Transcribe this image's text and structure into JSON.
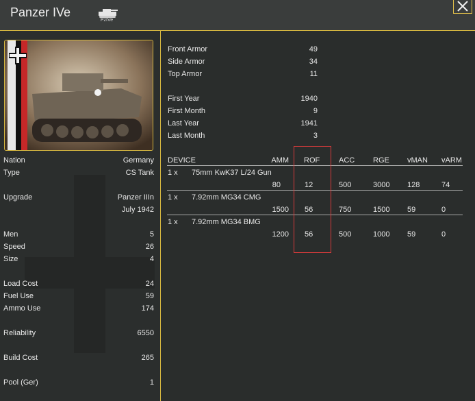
{
  "header": {
    "title": "Panzer IVe",
    "unit_icon_label": "PzIVe"
  },
  "left": {
    "rows": [
      {
        "label": "Nation",
        "value": "Germany"
      },
      {
        "label": "Type",
        "value": "CS Tank"
      },
      {
        "label": "Upgrade",
        "value": "Panzer IIIn"
      },
      {
        "label": "",
        "value": "July 1942"
      },
      {
        "label": "Men",
        "value": "5"
      },
      {
        "label": "Speed",
        "value": "26"
      },
      {
        "label": "Size",
        "value": "4"
      },
      {
        "label": "Load Cost",
        "value": "24"
      },
      {
        "label": "Fuel Use",
        "value": "59"
      },
      {
        "label": "Ammo Use",
        "value": "174"
      },
      {
        "label": "Reliability",
        "value": "6550"
      },
      {
        "label": "Build Cost",
        "value": "265"
      },
      {
        "label": "Pool (Ger)",
        "value": "1"
      }
    ]
  },
  "armor": [
    {
      "label": "Front Armor",
      "value": "49"
    },
    {
      "label": "Side Armor",
      "value": "34"
    },
    {
      "label": "Top Armor",
      "value": "11"
    }
  ],
  "dates": [
    {
      "label": "First Year",
      "value": "1940"
    },
    {
      "label": "First Month",
      "value": "9"
    },
    {
      "label": "Last Year",
      "value": "1941"
    },
    {
      "label": "Last Month",
      "value": "3"
    }
  ],
  "devices": {
    "headers": {
      "device": "DEVICE",
      "amm": "AMM",
      "rof": "ROF",
      "acc": "ACC",
      "rge": "RGE",
      "vman": "vMAN",
      "varm": "vARM"
    },
    "rows": [
      {
        "qty": "1 x",
        "name": "75mm KwK37 L/24 Gun",
        "amm": "80",
        "rof": "12",
        "acc": "500",
        "rge": "3000",
        "vman": "128",
        "varm": "74"
      },
      {
        "qty": "1 x",
        "name": "7.92mm MG34 CMG",
        "amm": "1500",
        "rof": "56",
        "acc": "750",
        "rge": "1500",
        "vman": "59",
        "varm": "0"
      },
      {
        "qty": "1 x",
        "name": "7.92mm MG34 BMG",
        "amm": "1200",
        "rof": "56",
        "acc": "500",
        "rge": "1000",
        "vman": "59",
        "varm": "0"
      }
    ]
  },
  "colors": {
    "accent": "#d4b640",
    "highlight": "#d93b3b",
    "panel": "#2b2e2d"
  }
}
